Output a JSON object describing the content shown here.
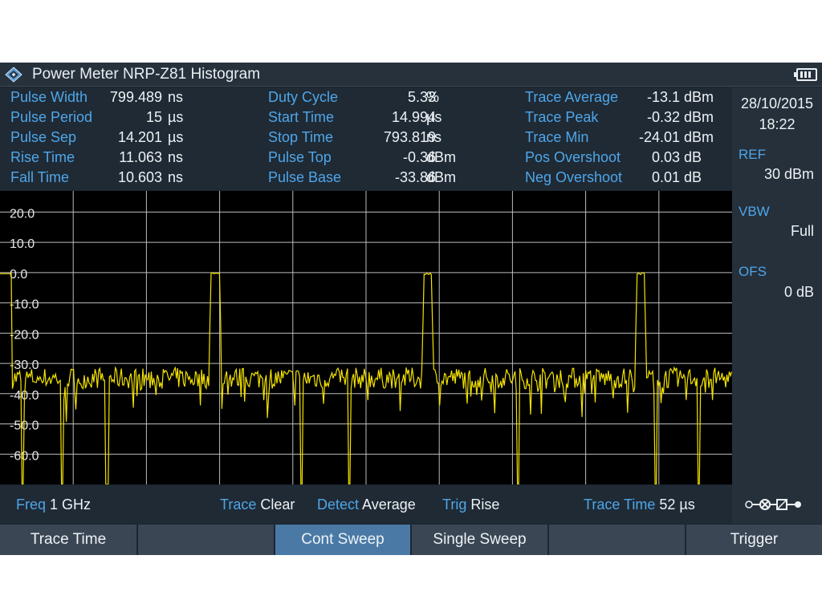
{
  "window": {
    "title": "Power Meter NRP-Z81 Histogram"
  },
  "measurements": [
    [
      {
        "label": "Pulse Width",
        "value": "799.489",
        "unit": "ns"
      },
      {
        "label": "Pulse Period",
        "value": "15",
        "unit": "µs"
      },
      {
        "label": "Pulse Sep",
        "value": "14.201",
        "unit": "µs"
      },
      {
        "label": "Rise Time",
        "value": "11.063",
        "unit": "ns"
      },
      {
        "label": "Fall Time",
        "value": "10.603",
        "unit": "ns"
      }
    ],
    [
      {
        "label": "Duty Cycle",
        "value": "5.33",
        "unit": "%"
      },
      {
        "label": "Start Time",
        "value": "14.994",
        "unit": "µs"
      },
      {
        "label": "Stop Time",
        "value": "793.819",
        "unit": "ns"
      },
      {
        "label": "Pulse Top",
        "value": "-0.36",
        "unit": "dBm"
      },
      {
        "label": "Pulse Base",
        "value": "-33.86",
        "unit": "dBm"
      }
    ],
    [
      {
        "label": "Trace Average",
        "value": "-13.1",
        "unit": "dBm"
      },
      {
        "label": "Trace Peak",
        "value": "-0.32",
        "unit": "dBm"
      },
      {
        "label": "Trace Min",
        "value": "-24.01",
        "unit": "dBm"
      },
      {
        "label": "Pos Overshoot",
        "value": "0.03",
        "unit": "dB"
      },
      {
        "label": "Neg Overshoot",
        "value": "0.01",
        "unit": "dB"
      }
    ]
  ],
  "side": {
    "date": "28/10/2015",
    "time": "18:22",
    "ref_label": "REF",
    "ref_value": "30 dBm",
    "vbw_label": "VBW",
    "vbw_value": "Full",
    "ofs_label": "OFS",
    "ofs_value": "0 dB"
  },
  "status": {
    "freq_label": "Freq",
    "freq_value": "1 GHz",
    "trace_label": "Trace",
    "trace_value": "Clear",
    "detect_label": "Detect",
    "detect_value": "Average",
    "trig_label": "Trig",
    "trig_value": "Rise",
    "tracetime_label": "Trace Time",
    "tracetime_value": "52 µs"
  },
  "softkeys": [
    "Trace Time",
    "",
    "Cont Sweep",
    "Single Sweep",
    "",
    "Trigger"
  ],
  "active_softkey": 2,
  "colors": {
    "trace": "#f4e300",
    "label": "#4fa6e8",
    "active": "#4a79a6"
  },
  "icons": {
    "logo": "rohde-schwarz-logo-icon",
    "battery": "battery-icon",
    "connector": "sensor-connector-icon"
  },
  "chart_data": {
    "type": "line",
    "y_ticks": [
      "20.0",
      "10.0",
      "0.0",
      "-10.0",
      "-20.0",
      "-30.0",
      "-40.0",
      "-50.0",
      "-60.0"
    ],
    "ylim": [
      -70,
      27
    ],
    "xlim": [
      0,
      52
    ],
    "x_unit": "µs",
    "grid": true,
    "pulses": [
      {
        "start": 14.9,
        "end": 15.7,
        "top": -0.36
      },
      {
        "start": 30.0,
        "end": 30.8,
        "top": -0.36
      },
      {
        "start": 45.1,
        "end": 45.9,
        "top": -0.36
      }
    ],
    "leading_high": {
      "start": 0,
      "end": 0.8,
      "top": -0.36
    },
    "pulse_base": -33.86,
    "dropouts_x": [
      1.6,
      4.4,
      7.6,
      15.0,
      21.4,
      24.8,
      36.8,
      46.6,
      49.6
    ],
    "dropout_min": -70
  }
}
